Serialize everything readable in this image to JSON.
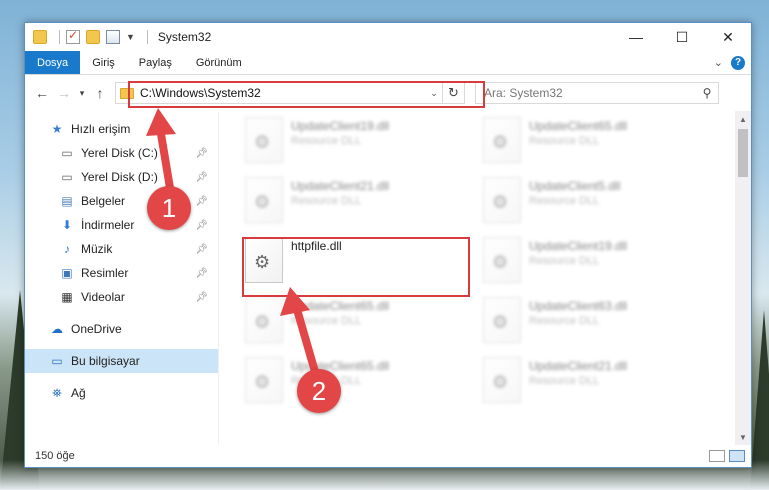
{
  "window": {
    "title": "System32",
    "controls": {
      "minimize": "—",
      "maximize": "☐",
      "close": "✕"
    }
  },
  "ribbon": {
    "tabs": [
      "Dosya",
      "Giriş",
      "Paylaş",
      "Görünüm"
    ],
    "active_tab": "Dosya",
    "help_label": "?"
  },
  "address": {
    "path": "C:\\Windows\\System32",
    "search_placeholder": "Ara: System32"
  },
  "nav": {
    "quick_access": "Hızlı erişim",
    "quick_items": [
      {
        "label": "Yerel Disk (C:)",
        "icon": "drive-icon"
      },
      {
        "label": "Yerel Disk (D:)",
        "icon": "drive-icon"
      },
      {
        "label": "Belgeler",
        "icon": "documents-icon"
      },
      {
        "label": "İndirmeler",
        "icon": "downloads-icon"
      },
      {
        "label": "Müzik",
        "icon": "music-icon"
      },
      {
        "label": "Resimler",
        "icon": "pictures-icon"
      },
      {
        "label": "Videolar",
        "icon": "videos-icon"
      }
    ],
    "onedrive": "OneDrive",
    "this_pc": "Bu bilgisayar",
    "network": "Ağ"
  },
  "files": {
    "left": [
      {
        "name": "UpdateClient19.dll",
        "desc": "Resource DLL"
      },
      {
        "name": "UpdateClient21.dll",
        "desc": "Resource DLL"
      },
      {
        "name": "httpfile.dll",
        "desc": ""
      },
      {
        "name": "UpdateClient65.dll",
        "desc": "Resource DLL"
      },
      {
        "name": "UpdateClient65.dll",
        "desc": "Resource DLL"
      }
    ],
    "right": [
      {
        "name": "UpdateClient65.dll",
        "desc": "Resource DLL"
      },
      {
        "name": "UpdateClient5.dll",
        "desc": "Resource DLL"
      },
      {
        "name": "UpdateClient19.dll",
        "desc": "Resource DLL"
      },
      {
        "name": "UpdateClient63.dll",
        "desc": "Resource DLL"
      },
      {
        "name": "UpdateClient21.dll",
        "desc": "Resource DLL"
      }
    ],
    "highlighted": "httpfile.dll"
  },
  "status": {
    "count": "150 öğe"
  },
  "annotations": {
    "badge1": "1",
    "badge2": "2",
    "color": "#e24646"
  }
}
